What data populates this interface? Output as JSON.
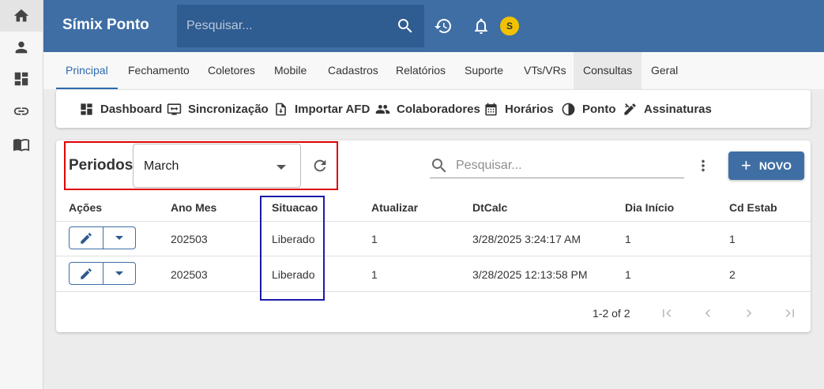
{
  "app": {
    "title": "Símix Ponto",
    "avatar_initial": "S"
  },
  "header": {
    "search_placeholder": "Pesquisar..."
  },
  "rail": {
    "icons": [
      "home-icon",
      "person-icon",
      "dashboard-icon",
      "link-icon",
      "book-icon"
    ]
  },
  "tabs": [
    "Principal",
    "Fechamento",
    "Coletores",
    "Mobile",
    "Cadastros",
    "Relatórios",
    "Suporte",
    "VTs/VRs",
    "Consultas",
    "Geral"
  ],
  "subnav": [
    "Dashboard",
    "Sincronização",
    "Importar AFD",
    "Colaboradores",
    "Horários",
    "Ponto",
    "Assinaturas"
  ],
  "periodos": {
    "label": "Periodos",
    "selected": "March"
  },
  "grid": {
    "search_placeholder": "Pesquisar...",
    "new_label": "NOVO",
    "columns": [
      "Ações",
      "Ano Mes",
      "Situacao",
      "Atualizar",
      "DtCalc",
      "Dia Início",
      "Cd Estab"
    ],
    "rows": [
      {
        "ano_mes": "202503",
        "situacao": "Liberado",
        "atualizar": "1",
        "dtcalc": "3/28/2025 3:24:17 AM",
        "dia_inicio": "1",
        "cd_estab": "1"
      },
      {
        "ano_mes": "202503",
        "situacao": "Liberado",
        "atualizar": "1",
        "dtcalc": "3/28/2025 12:13:58 PM",
        "dia_inicio": "1",
        "cd_estab": "2"
      }
    ],
    "pagination": "1-2 of 2"
  },
  "colors": {
    "primary": "#3f6ea4",
    "search_bg": "#2f5c91",
    "highlight_red": "#e00000",
    "highlight_blue": "#1a1aa8",
    "avatar": "#f2c200"
  }
}
